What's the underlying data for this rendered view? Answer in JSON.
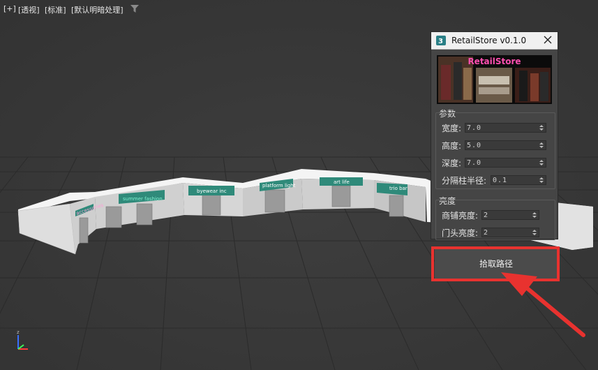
{
  "viewport": {
    "labels": [
      "[+]",
      "[透视]",
      "[标准]",
      "[默认明暗处理]"
    ],
    "storefront_signs": [
      "summer fashion",
      "byewear inc",
      "platform light",
      "art life",
      "trio bar",
      "accessories"
    ]
  },
  "dialog": {
    "title": "RetailStore v0.1.0",
    "banner_title": "RetailStore",
    "params_group": "参数",
    "params": [
      {
        "label": "宽度:",
        "value": "7.0"
      },
      {
        "label": "高度:",
        "value": "5.0"
      },
      {
        "label": "深度:",
        "value": "7.0"
      },
      {
        "label": "分隔柱半径:",
        "value": "0.1"
      }
    ],
    "brightness_group": "亮度",
    "brightness": [
      {
        "label": "商铺亮度:",
        "value": "2"
      },
      {
        "label": "门头亮度:",
        "value": "2"
      }
    ],
    "pick_path_label": "拾取路径"
  },
  "colors": {
    "highlight": "#e8322f",
    "banner_title": "#ff4fb0"
  }
}
